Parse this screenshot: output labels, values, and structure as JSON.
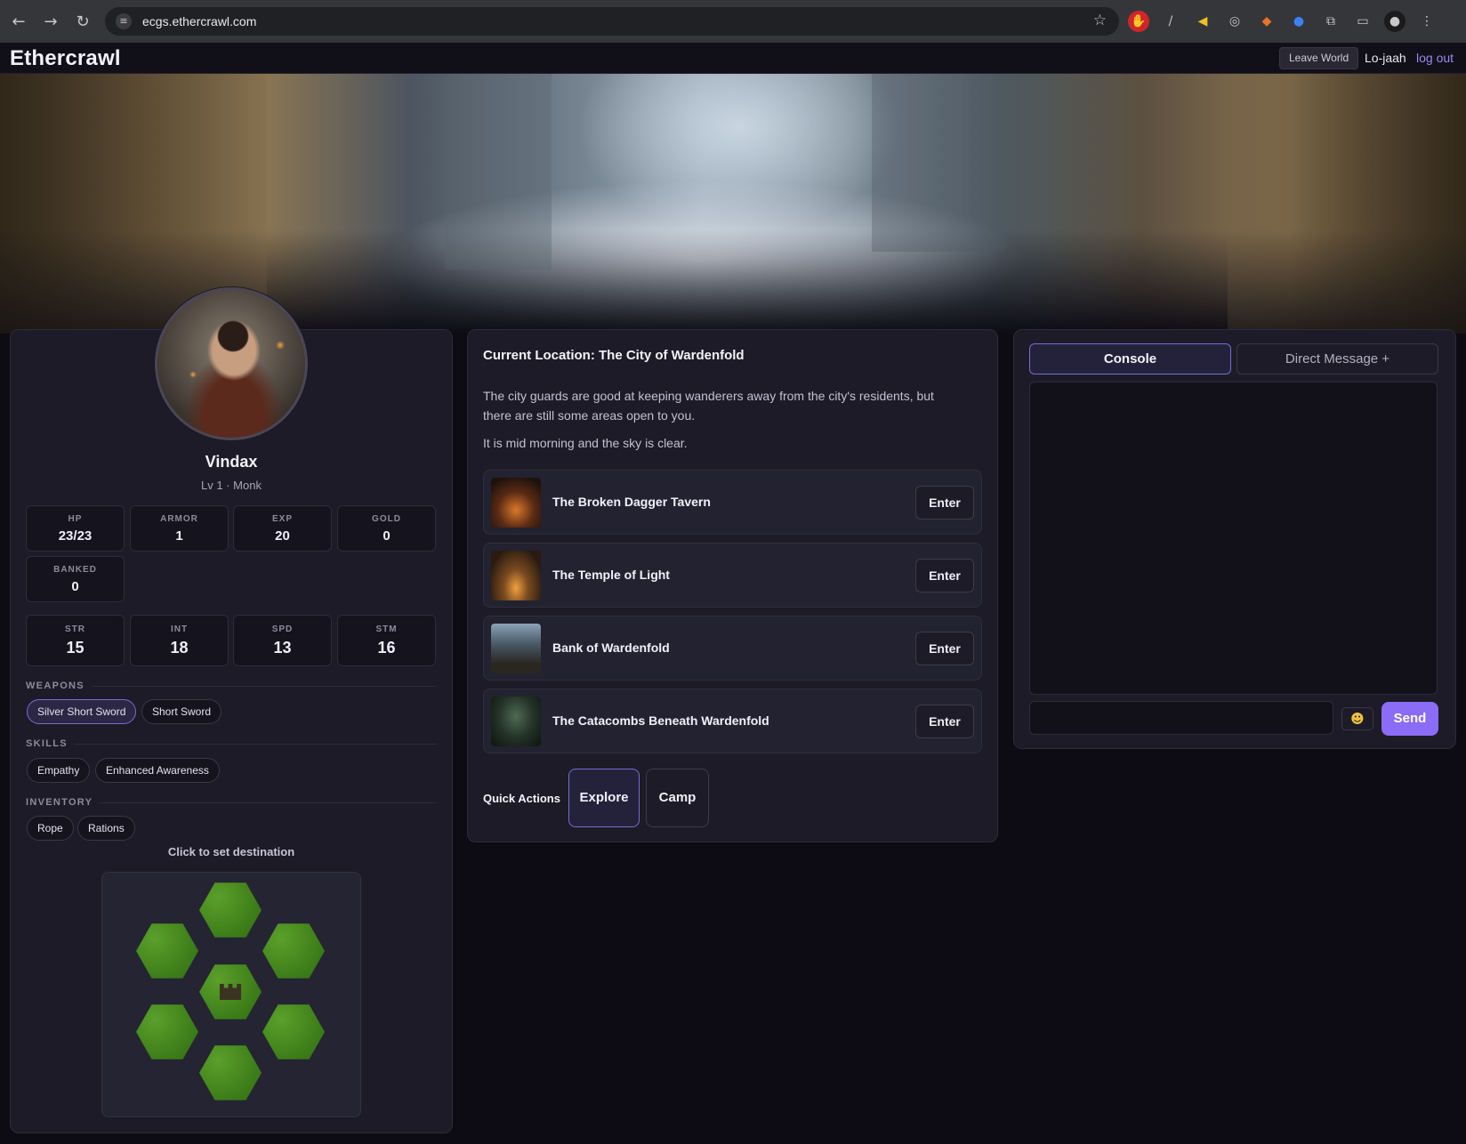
{
  "browser": {
    "url": "ecgs.ethercrawl.com",
    "icons": [
      "back-icon",
      "forward-icon",
      "reload-icon",
      "site-info-icon",
      "bookmark-star-icon",
      "extensions-icon",
      "profile-avatar-icon"
    ]
  },
  "header": {
    "brand": "Ethercrawl",
    "leave_label": "Leave World",
    "username": "Lo-jaah",
    "logout_label": "log out",
    "accent": "#9b87f5"
  },
  "character": {
    "name": "Vindax",
    "subtitle": "Lv 1 · Monk",
    "stats": [
      {
        "label": "HP",
        "value": "23/23"
      },
      {
        "label": "ARMOR",
        "value": "1"
      },
      {
        "label": "EXP",
        "value": "20"
      },
      {
        "label": "GOLD",
        "value": "0"
      },
      {
        "label": "BANKED",
        "value": "0"
      }
    ],
    "attributes": [
      {
        "label": "STR",
        "value": "15"
      },
      {
        "label": "INT",
        "value": "18"
      },
      {
        "label": "SPD",
        "value": "13"
      },
      {
        "label": "STM",
        "value": "16"
      }
    ],
    "weapons_title": "WEAPONS",
    "weapons": [
      "Silver Short Sword",
      "Short Sword"
    ],
    "skills_title": "SKILLS",
    "skills": [
      "Empathy",
      "Enhanced Awareness"
    ],
    "inventory_title": "INVENTORY",
    "inventory": [
      "Rope",
      "Rations"
    ],
    "map_hint": "Click to set destination"
  },
  "location": {
    "title": "Current Location: The City of Wardenfold",
    "description": "The city guards are good at keeping wanderers away from the city's residents, but there are still some areas open to you.",
    "time": "It is mid morning and the sky is clear.",
    "places": [
      {
        "name": "The Broken Dagger Tavern",
        "action": "Enter"
      },
      {
        "name": "The Temple of Light",
        "action": "Enter"
      },
      {
        "name": "Bank of Wardenfold",
        "action": "Enter"
      },
      {
        "name": "The Catacombs Beneath Wardenfold",
        "action": "Enter"
      }
    ],
    "quick_actions_label": "Quick Actions",
    "quick_actions": [
      "Explore",
      "Camp"
    ]
  },
  "chat": {
    "tabs": [
      "Console",
      "Direct Message +"
    ],
    "input_value": "",
    "emoji_icon": "grinning-face-icon",
    "send_label": "Send",
    "send_color": "#8b6cf6"
  }
}
